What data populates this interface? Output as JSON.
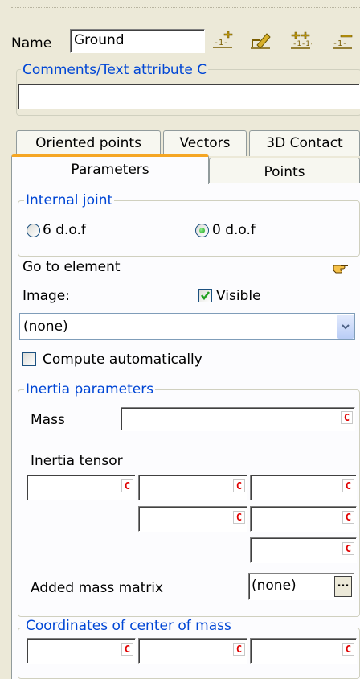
{
  "name_label": "Name",
  "name_value": "Ground",
  "toolbar_icons": [
    "add-point-icon",
    "edit-icon",
    "add-multiple-icon",
    "remove-icon"
  ],
  "comments": {
    "legend": "Comments/Text attribute C",
    "value": ""
  },
  "tabs_row1": [
    "Oriented points",
    "Vectors",
    "3D Contact"
  ],
  "tabs_row2": {
    "active": "Parameters",
    "other": "Points"
  },
  "internal_joint": {
    "legend": "Internal joint",
    "option_6dof": "6 d.o.f",
    "option_0dof": "0 d.o.f",
    "selected": "0 d.o.f"
  },
  "goto_label": "Go to element",
  "image": {
    "label": "Image:",
    "visible_label": "Visible",
    "visible_checked": true,
    "select_value": "(none)"
  },
  "compute_auto": {
    "label": "Compute automatically",
    "checked": false
  },
  "inertia": {
    "legend": "Inertia parameters",
    "mass_label": "Mass",
    "tensor_label": "Inertia tensor",
    "added_mass_label": "Added mass matrix",
    "added_mass_value": "(none)",
    "browse_label": "...",
    "c_marker": "C"
  },
  "center_of_mass": {
    "legend": "Coordinates of center of mass"
  },
  "colors": {
    "legend_blue": "#0046d5",
    "active_tab_top": "#f5a623",
    "c_marker": "#e00000"
  }
}
